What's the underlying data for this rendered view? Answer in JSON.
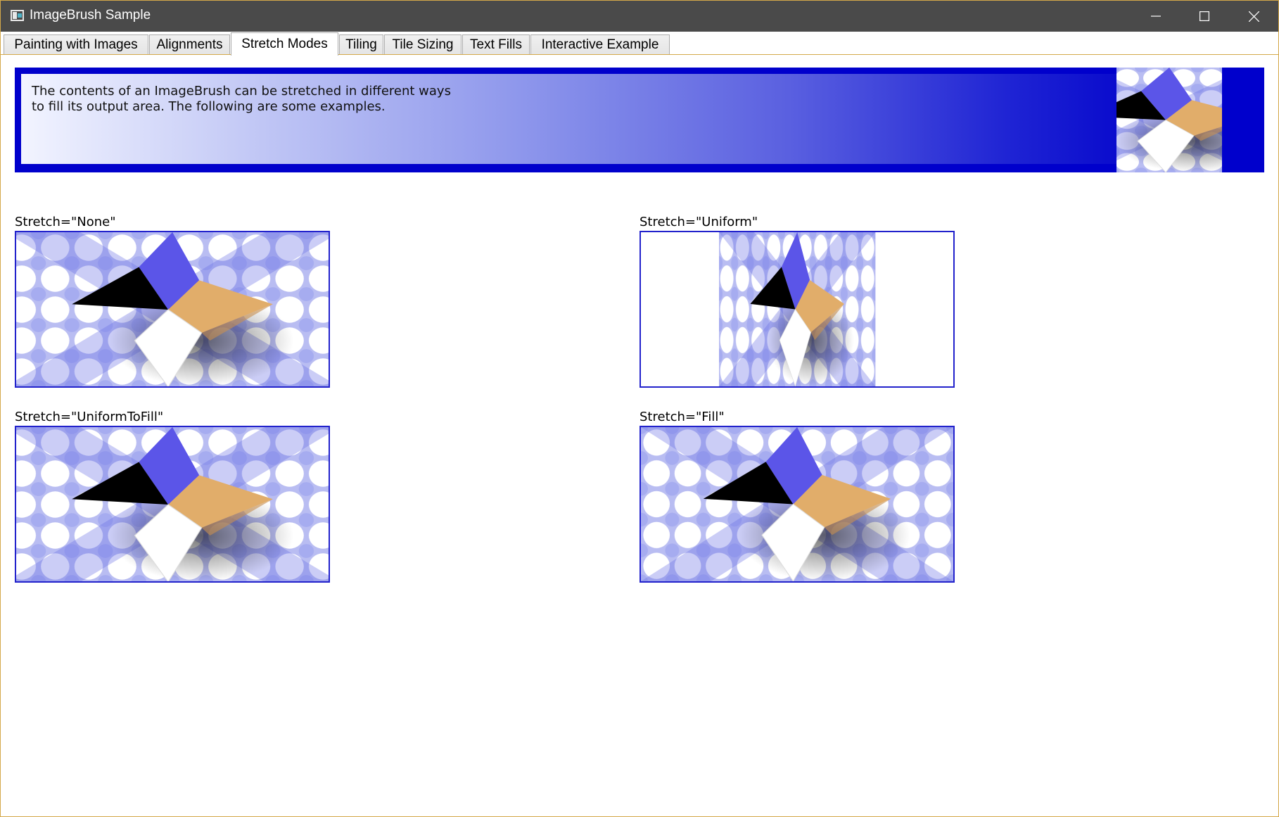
{
  "window": {
    "title": "ImageBrush Sample",
    "controls": {
      "minimize_icon": "minimize-icon",
      "maximize_icon": "maximize-icon",
      "close_icon": "close-icon"
    }
  },
  "tabs": [
    {
      "label": "Painting with Images",
      "active": false
    },
    {
      "label": "Alignments",
      "active": false
    },
    {
      "label": "Stretch Modes",
      "active": true
    },
    {
      "label": "Tiling",
      "active": false
    },
    {
      "label": "Tile Sizing",
      "active": false
    },
    {
      "label": "Text Fills",
      "active": false
    },
    {
      "label": "Interactive Example",
      "active": false
    }
  ],
  "banner": {
    "line1": "The contents of an ImageBrush can be stretched in different ways",
    "line2": "to fill its output area. The following are some examples."
  },
  "examples": {
    "none": {
      "label": "Stretch=\"None\""
    },
    "uniform": {
      "label": "Stretch=\"Uniform\""
    },
    "uniform_to_fill": {
      "label": "Stretch=\"UniformToFill\""
    },
    "fill": {
      "label": "Stretch=\"Fill\""
    }
  },
  "colors": {
    "accent": "#0000cc",
    "frame_border": "#2222cc",
    "window_border": "#d4a94a",
    "titlebar": "#4a4a4a"
  }
}
